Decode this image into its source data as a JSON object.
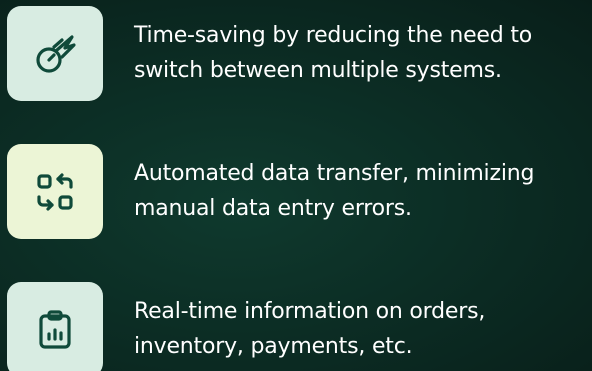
{
  "colors": {
    "background": "#0b2a22",
    "icon_stroke": "#0f4a3a",
    "text": "#ffffff"
  },
  "features": [
    {
      "icon": "speed-meteor-icon",
      "icon_bg": "#d8ece2",
      "line1": "Time-saving by reducing the need to",
      "line2": "switch between multiple systems."
    },
    {
      "icon": "sync-transfer-icon",
      "icon_bg": "#ecf5d6",
      "line1": "Automated data transfer, minimizing",
      "line2": "manual data entry errors."
    },
    {
      "icon": "clipboard-chart-icon",
      "icon_bg": "#d8ece2",
      "line1": "Real-time information on orders,",
      "line2": "inventory, payments, etc."
    }
  ]
}
